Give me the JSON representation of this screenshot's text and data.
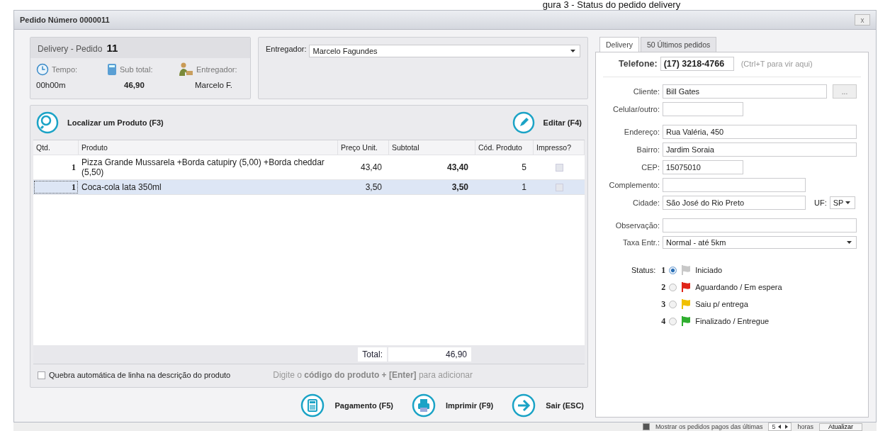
{
  "caption": "gura 3 - Status do pedido delivery",
  "window": {
    "title": "Pedido Número 0000011",
    "close": "x"
  },
  "summary": {
    "heading": "Delivery - Pedido",
    "number": "11",
    "tempo_label": "Tempo:",
    "subtotal_label": "Sub total:",
    "entregador_label": "Entregador:",
    "tempo": "00h00m",
    "subtotal": "46,90",
    "entregador": "Marcelo F."
  },
  "entregador_select": {
    "label": "Entregador:",
    "value": "Marcelo Fagundes"
  },
  "products": {
    "search_button": "Localizar um Produto (F3)",
    "edit_button": "Editar (F4)",
    "columns": [
      "Qtd.",
      "Produto",
      "Preço Unit.",
      "Subtotal",
      "Cód. Produto",
      "Impresso?"
    ],
    "rows": [
      {
        "qty": "1",
        "product": "Pizza Grande Mussarela +Borda catupiry (5,00) +Borda cheddar (5,50)",
        "price": "43,40",
        "subtotal": "43,40",
        "code": "5",
        "printed": false,
        "selected": false
      },
      {
        "qty": "1",
        "product": "Coca-cola lata 350ml",
        "price": "3,50",
        "subtotal": "3,50",
        "code": "1",
        "printed": false,
        "selected": true
      }
    ],
    "total_label": "Total:",
    "total": "46,90",
    "wrap_checkbox": {
      "label": "Quebra automática de linha na descrição do produto",
      "checked": false
    },
    "hint": "Digite o **código do produto + [Enter]** para adicionar"
  },
  "actions": [
    {
      "kind": "payment",
      "label": "Pagamento (F5)"
    },
    {
      "kind": "print",
      "label": "Imprimir (F9)"
    },
    {
      "kind": "exit",
      "label": "Sair (ESC)"
    }
  ],
  "tabs": [
    {
      "label": "Delivery",
      "selected": true
    },
    {
      "label": "50 Últimos pedidos",
      "selected": false
    }
  ],
  "delivery": {
    "phone_label": "Telefone:",
    "phone": "(17) 3218-4766",
    "phone_hint": "(Ctrl+T para vir aqui)",
    "cliente_label": "Cliente:",
    "cliente": "Bill Gates",
    "more_button": "...",
    "celular_label": "Celular/outro:",
    "endereco_label": "Endereço:",
    "endereco": "Rua Valéria, 450",
    "bairro_label": "Bairro:",
    "bairro": "Jardim Soraia",
    "cep_label": "CEP:",
    "cep": "15075010",
    "complemento_label": "Complemento:",
    "cidade_label": "Cidade:",
    "cidade": "São José do Rio Preto",
    "uf_label": "UF:",
    "uf": "SP",
    "obs_label": "Observação:",
    "taxa_label": "Taxa Entr.:",
    "taxa": "Normal - até 5km",
    "status_label": "Status:",
    "statuses": [
      {
        "number": "1",
        "label": "Iniciado",
        "color": "#c8c8c8",
        "selected": true
      },
      {
        "number": "2",
        "label": "Aguardando / Em espera",
        "color": "#e02418",
        "selected": false
      },
      {
        "number": "3",
        "label": "Saiu p/ entrega",
        "color": "#f0c000",
        "selected": false
      },
      {
        "number": "4",
        "label": "Finalizado / Entregue",
        "color": "#2fae2f",
        "selected": false
      }
    ]
  },
  "bottom_bar": {
    "checkbox": {
      "label": "Mostrar os pedidos pagos das últimas",
      "checked": true
    },
    "hours": "5",
    "hours_label": "horas",
    "refresh_button": "Atualizar"
  }
}
